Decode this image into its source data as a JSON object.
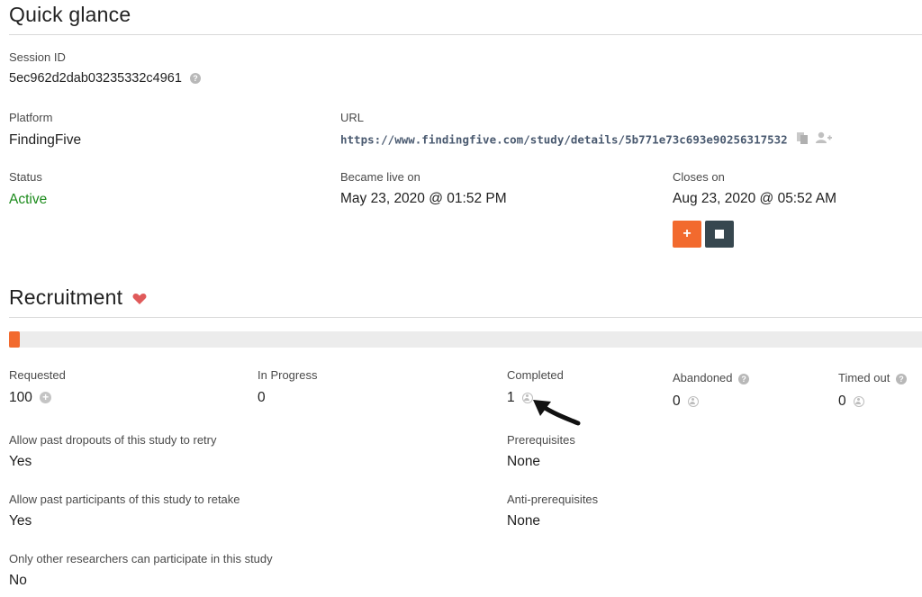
{
  "quick_glance": {
    "title": "Quick glance",
    "session_id_label": "Session ID",
    "session_id": "5ec962d2dab03235332c4961",
    "platform_label": "Platform",
    "platform": "FindingFive",
    "url_label": "URL",
    "url": "https://www.findingfive.com/study/details/5b771e73c693e90256317532",
    "status_label": "Status",
    "status": "Active",
    "became_live_label": "Became live on",
    "became_live": "May 23, 2020 @ 01:52 PM",
    "closes_label": "Closes on",
    "closes": "Aug 23, 2020 @ 05:52 AM",
    "extend_button": "+"
  },
  "recruitment": {
    "title": "Recruitment",
    "progress_fraction": 0.01,
    "requested_label": "Requested",
    "requested": "100",
    "in_progress_label": "In Progress",
    "in_progress": "0",
    "completed_label": "Completed",
    "completed": "1",
    "abandoned_label": "Abandoned",
    "abandoned": "0",
    "timed_out_label": "Timed out",
    "timed_out": "0",
    "retry_label": "Allow past dropouts of this study to retry",
    "retry": "Yes",
    "retake_label": "Allow past participants of this study to retake",
    "retake": "Yes",
    "researchers_label": "Only other researchers can participate in this study",
    "researchers": "No",
    "prereq_label": "Prerequisites",
    "prereq": "None",
    "anti_prereq_label": "Anti-prerequisites",
    "anti_prereq": "None"
  },
  "icons": {
    "help": "?",
    "heart_color": "#e05a5a",
    "accent": "#f26a2e",
    "dark": "#37474f"
  }
}
